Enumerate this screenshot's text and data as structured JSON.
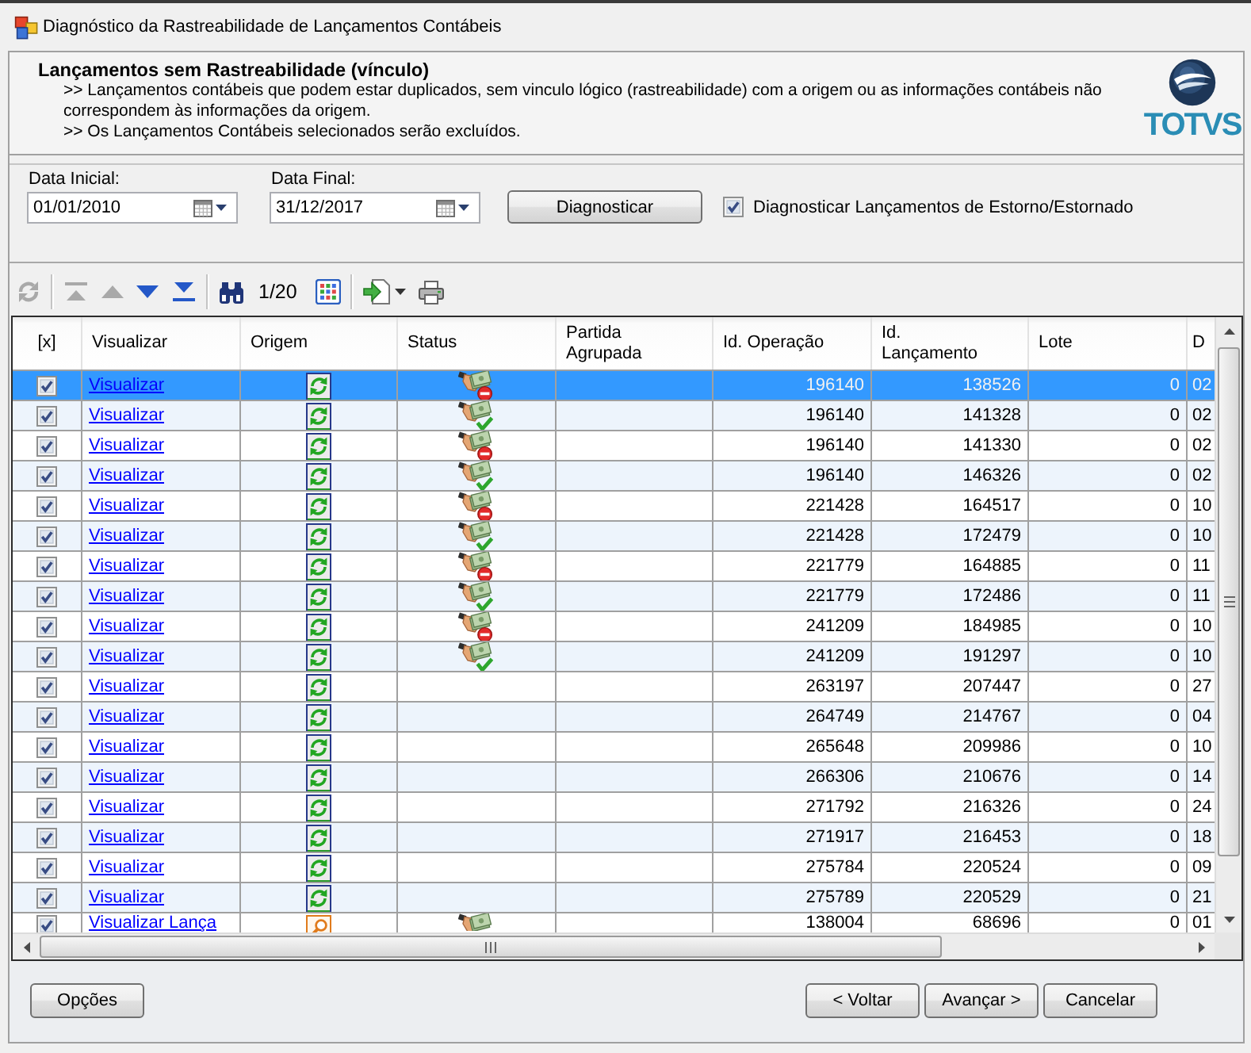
{
  "window": {
    "title": "Diagnóstico da Rastreabilidade de Lançamentos Contábeis"
  },
  "header": {
    "title": "Lançamentos sem Rastreabilidade (vínculo)",
    "lines": [
      ">> Lançamentos contábeis que podem estar duplicados, sem vinculo lógico (rastreabilidade) com a origem ou as informações contábeis não correspondem às informações da origem.",
      ">> Os Lançamentos Contábeis selecionados serão excluídos."
    ],
    "logo": "TOTVS"
  },
  "filters": {
    "start_date": {
      "label": "Data Inicial:",
      "value": "01/01/2010"
    },
    "end_date": {
      "label": "Data Final:",
      "value": "31/12/2017"
    },
    "diagnose_button": "Diagnosticar",
    "reversal_checkbox": {
      "label": "Diagnosticar Lançamentos de Estorno/Estornado",
      "checked": true
    }
  },
  "toolbar": {
    "items": [
      {
        "kind": "refresh",
        "disabled": true
      },
      {
        "kind": "separator"
      },
      {
        "kind": "first",
        "disabled": true
      },
      {
        "kind": "previous",
        "disabled": true
      },
      {
        "kind": "next",
        "disabled": false
      },
      {
        "kind": "last",
        "disabled": false
      },
      {
        "kind": "separator"
      },
      {
        "kind": "find",
        "disabled": false
      },
      {
        "kind": "page",
        "text": "1/20"
      },
      {
        "kind": "columns",
        "disabled": false
      },
      {
        "kind": "separator"
      },
      {
        "kind": "export",
        "disabled": false
      },
      {
        "kind": "print",
        "disabled": false
      }
    ]
  },
  "table": {
    "columns": [
      "[x]",
      "Visualizar",
      "Origem",
      "Status",
      "Partida Agrupada",
      "Id. Operação",
      "Id. Lançamento",
      "Lote",
      "D"
    ],
    "rows": [
      {
        "selected": true,
        "checked": true,
        "link": "Visualizar",
        "origin": {
          "kind": "sync"
        },
        "status": {
          "kind": "cash-minus"
        },
        "operation_id": "196140",
        "entry_id": "138526",
        "batch": "0",
        "column_9": "02"
      },
      {
        "selected": false,
        "checked": true,
        "link": "Visualizar",
        "origin": {
          "kind": "sync"
        },
        "status": {
          "kind": "cash-check"
        },
        "operation_id": "196140",
        "entry_id": "141328",
        "batch": "0",
        "column_9": "02"
      },
      {
        "selected": false,
        "checked": true,
        "link": "Visualizar",
        "origin": {
          "kind": "sync"
        },
        "status": {
          "kind": "cash-minus"
        },
        "operation_id": "196140",
        "entry_id": "141330",
        "batch": "0",
        "column_9": "02"
      },
      {
        "selected": false,
        "checked": true,
        "link": "Visualizar",
        "origin": {
          "kind": "sync"
        },
        "status": {
          "kind": "cash-check"
        },
        "operation_id": "196140",
        "entry_id": "146326",
        "batch": "0",
        "column_9": "02"
      },
      {
        "selected": false,
        "checked": true,
        "link": "Visualizar",
        "origin": {
          "kind": "sync"
        },
        "status": {
          "kind": "cash-minus"
        },
        "operation_id": "221428",
        "entry_id": "164517",
        "batch": "0",
        "column_9": "10"
      },
      {
        "selected": false,
        "checked": true,
        "link": "Visualizar",
        "origin": {
          "kind": "sync"
        },
        "status": {
          "kind": "cash-check"
        },
        "operation_id": "221428",
        "entry_id": "172479",
        "batch": "0",
        "column_9": "10"
      },
      {
        "selected": false,
        "checked": true,
        "link": "Visualizar",
        "origin": {
          "kind": "sync"
        },
        "status": {
          "kind": "cash-minus"
        },
        "operation_id": "221779",
        "entry_id": "164885",
        "batch": "0",
        "column_9": "11"
      },
      {
        "selected": false,
        "checked": true,
        "link": "Visualizar",
        "origin": {
          "kind": "sync"
        },
        "status": {
          "kind": "cash-check"
        },
        "operation_id": "221779",
        "entry_id": "172486",
        "batch": "0",
        "column_9": "11"
      },
      {
        "selected": false,
        "checked": true,
        "link": "Visualizar",
        "origin": {
          "kind": "sync"
        },
        "status": {
          "kind": "cash-minus"
        },
        "operation_id": "241209",
        "entry_id": "184985",
        "batch": "0",
        "column_9": "10"
      },
      {
        "selected": false,
        "checked": true,
        "link": "Visualizar",
        "origin": {
          "kind": "sync"
        },
        "status": {
          "kind": "cash-check"
        },
        "operation_id": "241209",
        "entry_id": "191297",
        "batch": "0",
        "column_9": "10"
      },
      {
        "selected": false,
        "checked": true,
        "link": "Visualizar",
        "origin": {
          "kind": "sync"
        },
        "operation_id": "263197",
        "entry_id": "207447",
        "batch": "0",
        "column_9": "27"
      },
      {
        "selected": false,
        "checked": true,
        "link": "Visualizar",
        "origin": {
          "kind": "sync"
        },
        "operation_id": "264749",
        "entry_id": "214767",
        "batch": "0",
        "column_9": "04"
      },
      {
        "selected": false,
        "checked": true,
        "link": "Visualizar",
        "origin": {
          "kind": "sync"
        },
        "operation_id": "265648",
        "entry_id": "209986",
        "batch": "0",
        "column_9": "10"
      },
      {
        "selected": false,
        "checked": true,
        "link": "Visualizar",
        "origin": {
          "kind": "sync"
        },
        "operation_id": "266306",
        "entry_id": "210676",
        "batch": "0",
        "column_9": "14"
      },
      {
        "selected": false,
        "checked": true,
        "link": "Visualizar",
        "origin": {
          "kind": "sync"
        },
        "operation_id": "271792",
        "entry_id": "216326",
        "batch": "0",
        "column_9": "24"
      },
      {
        "selected": false,
        "checked": true,
        "link": "Visualizar",
        "origin": {
          "kind": "sync"
        },
        "operation_id": "271917",
        "entry_id": "216453",
        "batch": "0",
        "column_9": "18"
      },
      {
        "selected": false,
        "checked": true,
        "link": "Visualizar",
        "origin": {
          "kind": "sync"
        },
        "operation_id": "275784",
        "entry_id": "220524",
        "batch": "0",
        "column_9": "09"
      },
      {
        "selected": false,
        "checked": true,
        "link": "Visualizar",
        "origin": {
          "kind": "sync"
        },
        "operation_id": "275789",
        "entry_id": "220529",
        "batch": "0",
        "column_9": "21"
      },
      {
        "selected": false,
        "checked": true,
        "link": "Visualizar Lança",
        "origin": {
          "kind": "magnifier"
        },
        "status": {
          "kind": "cash"
        },
        "operation_id": "138004",
        "entry_id": "68696",
        "batch": "0",
        "column_9": "01"
      }
    ]
  },
  "footer": {
    "left_buttons": [
      "Opções"
    ],
    "right_buttons": [
      "< Voltar",
      "Avançar >",
      "Cancelar"
    ]
  }
}
